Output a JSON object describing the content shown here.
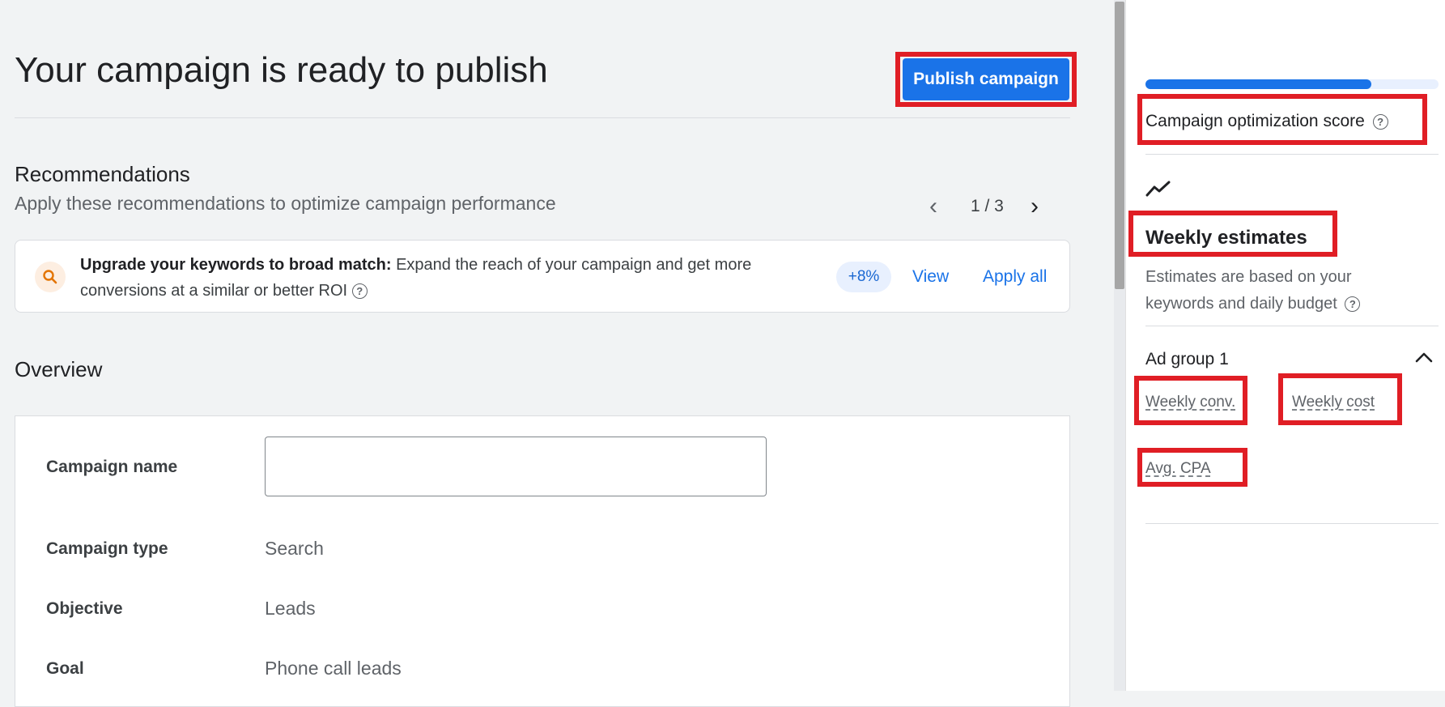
{
  "header": {
    "title": "Your campaign is ready to publish",
    "publish_button": "Publish campaign"
  },
  "recommendations": {
    "title": "Recommendations",
    "subtitle": "Apply these recommendations to optimize campaign performance",
    "pager": "1 / 3",
    "card": {
      "icon": "search-icon",
      "title": "Upgrade your keywords to broad match:",
      "body": "Expand the reach of your campaign and get more conversions at a similar or better ROI",
      "badge": "+8%",
      "view": "View",
      "apply_all": "Apply all"
    }
  },
  "overview": {
    "title": "Overview",
    "campaign_name_label": "Campaign name",
    "campaign_name_value": "",
    "campaign_type_label": "Campaign type",
    "campaign_type_value": "Search",
    "objective_label": "Objective",
    "objective_value": "Leads",
    "goal_label": "Goal",
    "goal_value": "Phone call leads"
  },
  "sidebar": {
    "optimization_score_fraction": 0.77,
    "optimization_score_label": "Campaign optimization score",
    "weekly_title": "Weekly estimates",
    "weekly_subtitle": "Estimates are based on your keywords and daily budget",
    "ad_group": "Ad group 1",
    "metrics": {
      "weekly_conv": "Weekly conv.",
      "weekly_cost": "Weekly cost",
      "avg_cpa": "Avg. CPA"
    }
  },
  "colors": {
    "primary": "#1a73e8",
    "highlight": "#e01e25",
    "badge_bg": "#e8f0fe",
    "search_icon": "#e37400"
  }
}
